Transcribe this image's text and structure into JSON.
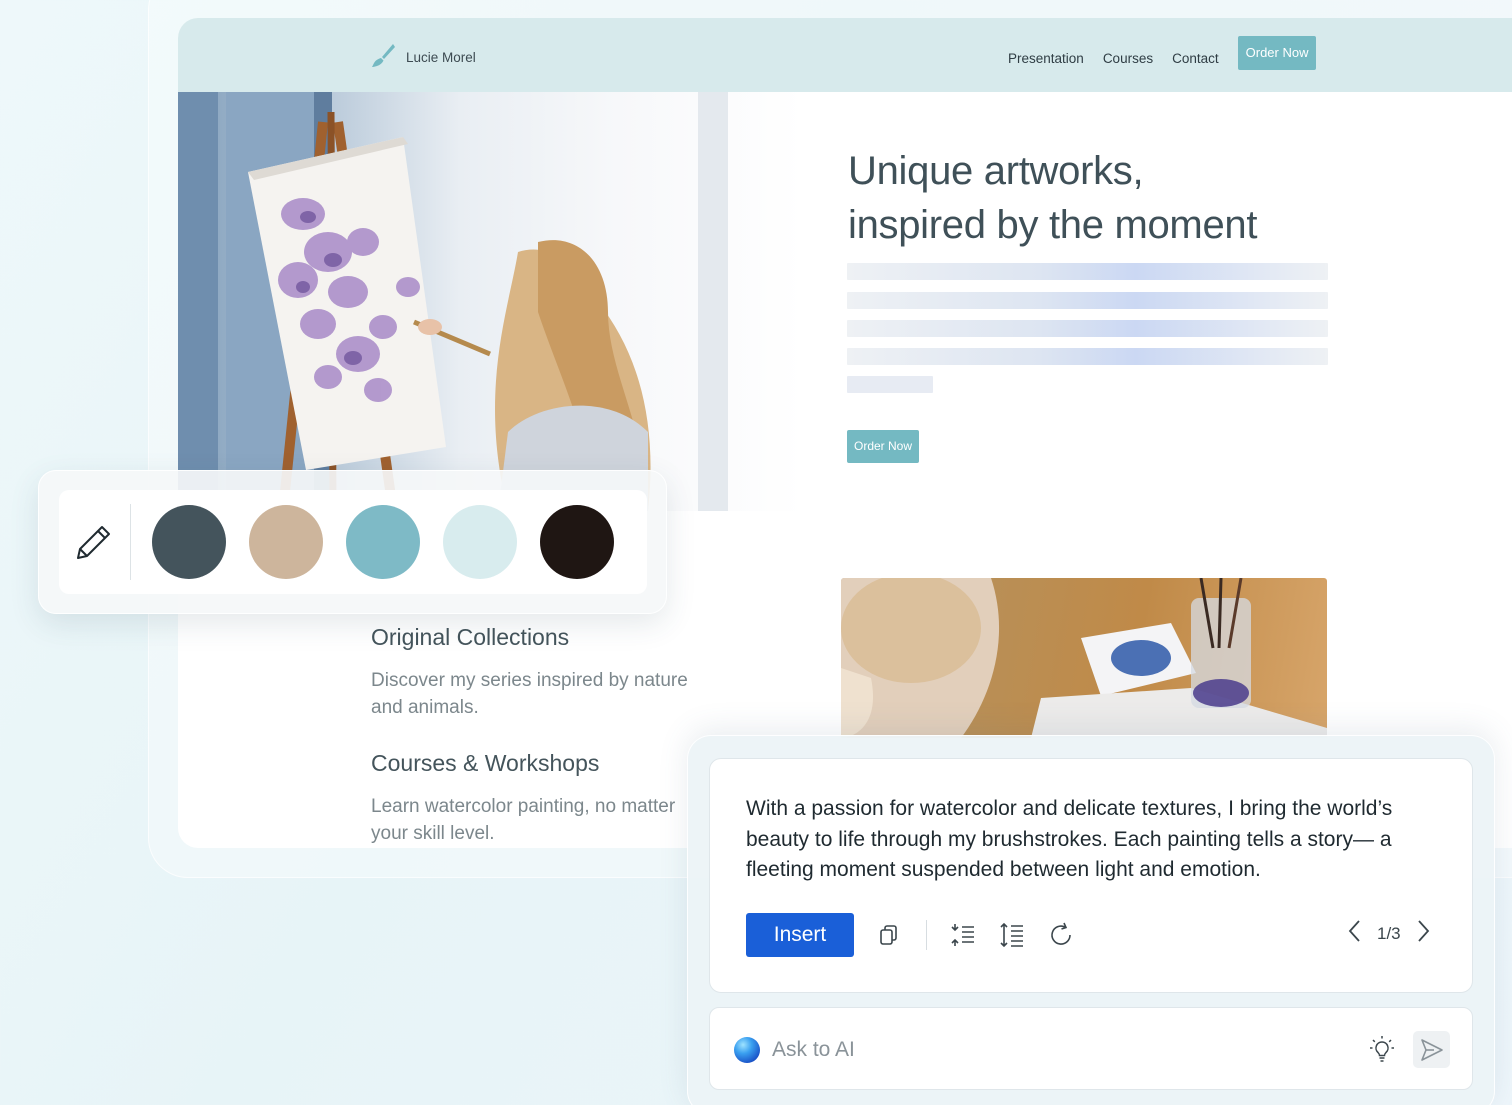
{
  "site": {
    "brand_name": "Lucie Morel",
    "nav": {
      "links": [
        "Presentation",
        "Courses",
        "Contact"
      ],
      "cta": "Order Now"
    },
    "hero": {
      "title_line1": "Unique artworks,",
      "title_line2": "inspired by the moment",
      "cta": "Order Now"
    },
    "features": [
      {
        "title": "Original Collections",
        "description": "Discover my series inspired by nature and animals."
      },
      {
        "title": "Courses & Workshops",
        "description": "Learn watercolor painting, no matter your skill level."
      }
    ]
  },
  "palette": {
    "tool_icon": "pencil-icon",
    "colors": [
      "#44545c",
      "#cdb59c",
      "#7ebac6",
      "#d8ecee",
      "#1f1613"
    ]
  },
  "ai": {
    "suggestion": "With a passion for watercolor and delicate textures, I bring the world’s beauty to life through my brushstrokes. Each painting tells a story— a fleeting moment suspended between light and emotion.",
    "insert_label": "Insert",
    "tools": [
      "copy-icon",
      "shorten-icon",
      "lengthen-icon",
      "regenerate-icon"
    ],
    "pager": "1/3",
    "ask_placeholder": "Ask to AI"
  },
  "colors": {
    "accent": "#74b9c2",
    "nav_bg": "#d7eaec",
    "primary_button": "#1a5fd8"
  }
}
